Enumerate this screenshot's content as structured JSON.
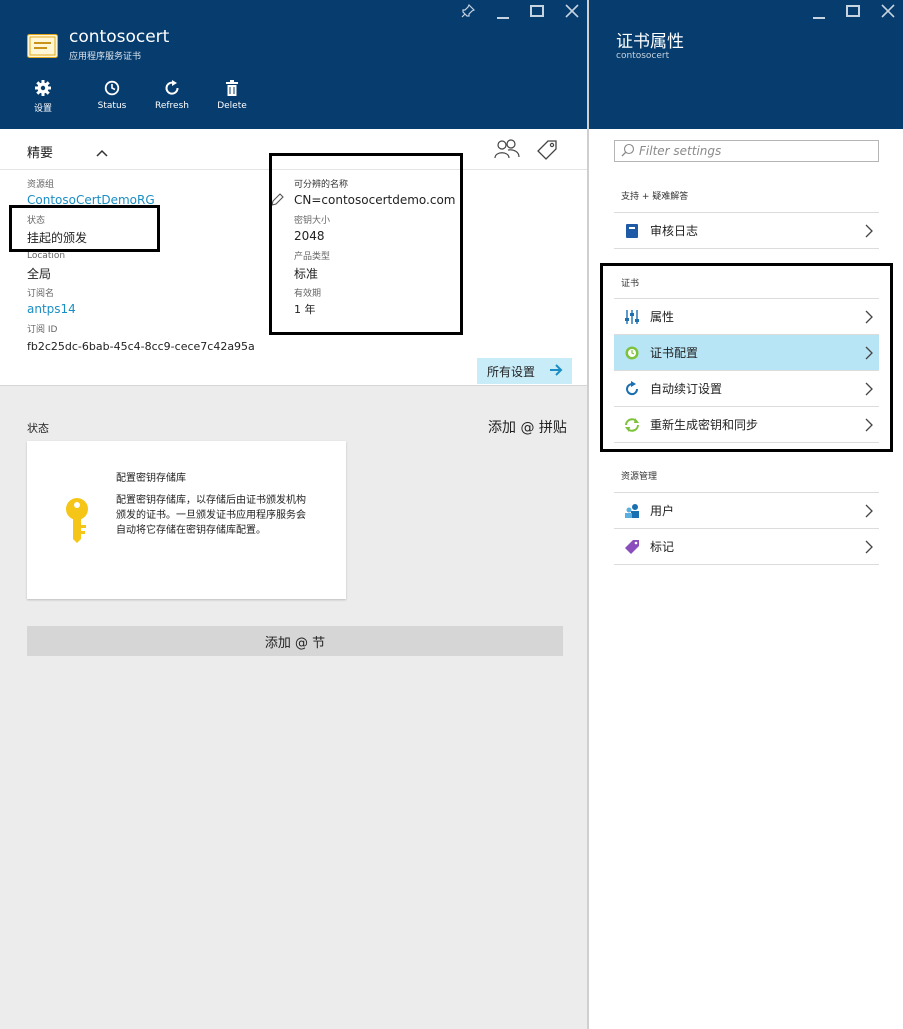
{
  "left_blade": {
    "title": "contosocert",
    "subtitle": "应用程序服务证书",
    "commands": [
      {
        "label": "设置",
        "icon": "gear-icon"
      },
      {
        "label": "Status",
        "icon": "history-icon"
      },
      {
        "label": "Refresh",
        "icon": "refresh-icon"
      },
      {
        "label": "Delete",
        "icon": "trash-icon"
      }
    ],
    "essentials": {
      "header": "精要",
      "resource_group_label": "资源组",
      "resource_group_value": "ContosoCertDemoRG",
      "status_label": "状态",
      "status_value": "挂起的颁发",
      "location_label": "Location",
      "location_value": "全局",
      "subscription_label": "订阅名",
      "subscription_value": "antps14",
      "subscription_id_label": "订阅 ID",
      "subscription_id_value": "fb2c25dc-6bab-45c4-8cc9-cece7c42a95a",
      "dn_label": "可分辨的名称",
      "dn_value": "CN=contosocertdemo.com",
      "key_size_label": "密钥大小",
      "key_size_value": "2048",
      "product_type_label": "产品类型",
      "product_type_value": "标准",
      "validity_label": "有效期",
      "validity_value": "1 年",
      "all_settings": "所有设置"
    },
    "status_section": {
      "label": "状态",
      "add_tile": "添加 @ 拼贴",
      "tile_title": "配置密钥存储库",
      "tile_body": "配置密钥存储库，以存储后由证书颁发机构颁发的证书。一旦颁发证书应用程序服务会自动将它存储在密钥存储库配置。",
      "add_section": "添加 @ 节"
    }
  },
  "right_blade": {
    "title": "证书属性",
    "subtitle": "contosocert",
    "filter_placeholder": "Filter settings",
    "groups": [
      {
        "label": "支持 + 疑难解答",
        "items": [
          {
            "label": "审核日志",
            "icon": "book-icon"
          }
        ]
      },
      {
        "label": "证书",
        "items": [
          {
            "label": "属性",
            "icon": "sliders-icon"
          },
          {
            "label": "证书配置",
            "icon": "clock-gear-icon"
          },
          {
            "label": "自动续订设置",
            "icon": "renew-icon"
          },
          {
            "label": "重新生成密钥和同步",
            "icon": "sync-icon"
          }
        ]
      },
      {
        "label": "资源管理",
        "items": [
          {
            "label": "用户",
            "icon": "users-icon"
          },
          {
            "label": "标记",
            "icon": "tag-icon"
          }
        ]
      }
    ]
  },
  "colors": {
    "header_bg": "#063c6e",
    "link": "#1a8ec4",
    "selected_item": "#b8e5f5",
    "key_yellow": "#f5c518"
  }
}
